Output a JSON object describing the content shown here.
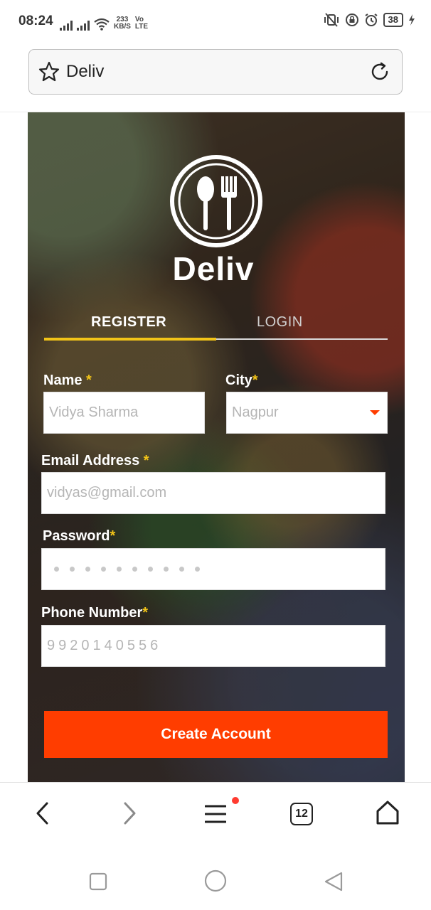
{
  "status_bar": {
    "time": "08:24",
    "speed_value": "233",
    "speed_unit": "KB/S",
    "volte_top": "Vo",
    "volte_bottom": "LTE",
    "battery": "38"
  },
  "browser": {
    "address_text": "Deliv",
    "tab_count": "12"
  },
  "page": {
    "brand": "Deliv",
    "tabs": {
      "register": "REGISTER",
      "login": "LOGIN"
    },
    "form": {
      "name_label": "Name",
      "name_value": "Vidya Sharma",
      "city_label": "City",
      "city_value": "Nagpur",
      "email_label": "Email Address",
      "email_value": "vidyas@gmail.com",
      "password_label": "Password",
      "password_dot_count": 10,
      "phone_label": "Phone Number",
      "phone_value": "9920140556",
      "required_marker": "*"
    },
    "create_button": "Create Account"
  },
  "colors": {
    "accent": "#ff3d00",
    "tab_highlight": "#f2c418"
  }
}
